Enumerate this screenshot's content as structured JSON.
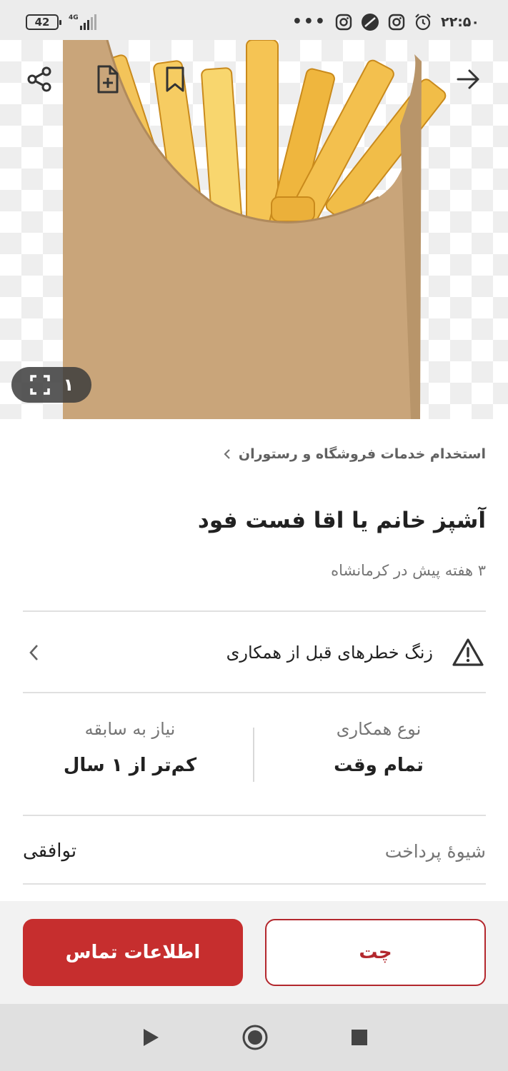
{
  "status_bar": {
    "battery": "42",
    "network": "4G",
    "overflow": "•••",
    "time": "۲۲:۵۰",
    "icons": [
      "instagram-icon",
      "round-app-icon",
      "instagram-icon",
      "alarm-icon"
    ]
  },
  "hero": {
    "image_counter": "۱",
    "icons": {
      "share": "share-icon",
      "add_note": "file-plus-icon",
      "bookmark": "bookmark-icon",
      "back": "arrow-right-icon",
      "fullscreen": "fullscreen-icon"
    }
  },
  "listing": {
    "breadcrumb": "استخدام خدمات فروشگاه و رستوران",
    "title": "آشپز خانم یا اقا فست فود",
    "subtitle": "۳ هفته پیش در کرمانشاه",
    "warning": "زنگ خطرهای قبل از همکاری",
    "cooperation_type": {
      "label": "نوع همکاری",
      "value": "تمام وقت"
    },
    "experience": {
      "label": "نیاز به سابقه",
      "value": "کم‌تر از ۱ سال"
    },
    "payment": {
      "label": "شیوهٔ پرداخت",
      "value": "توافقی"
    }
  },
  "actions": {
    "contact_label": "اطلاعات تماس",
    "chat_label": "چت"
  },
  "colors": {
    "primary": "#c62e2e",
    "chat_border": "#b3272d"
  },
  "nav": {
    "icons": [
      "back-triangle-icon",
      "home-circle-icon",
      "recents-square-icon"
    ]
  }
}
